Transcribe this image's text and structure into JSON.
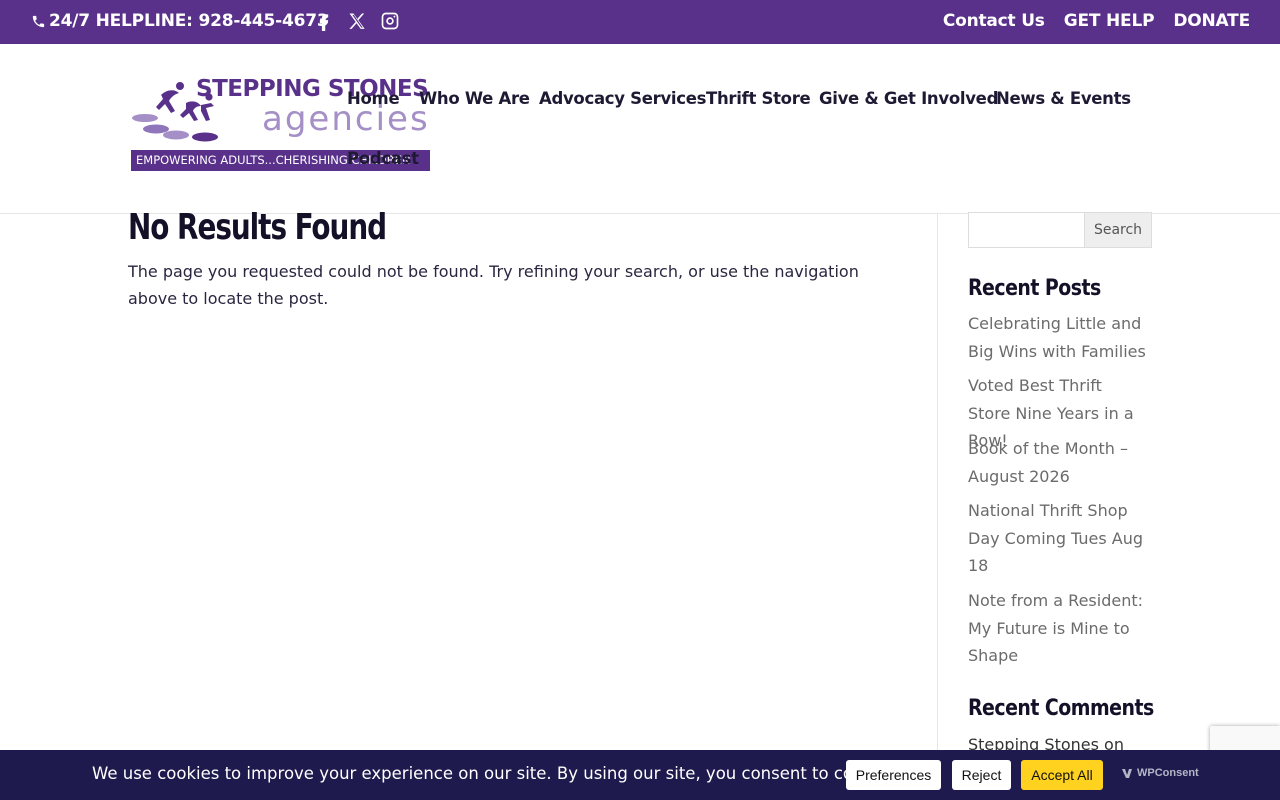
{
  "topbar": {
    "helpline": "24/7 HELPLINE: 928-445-4673",
    "links": [
      "Contact Us",
      "GET HELP",
      "DONATE"
    ],
    "social": [
      "facebook-icon",
      "x-icon",
      "instagram-icon"
    ]
  },
  "logo": {
    "title": "STEPPING STONES",
    "subtitle": "agencies",
    "tagline": "EMPOWERING ADULTS...CHERISHING CHILDREN"
  },
  "nav": {
    "items": [
      "Home",
      "Who We Are",
      "Advocacy Services",
      "Thrift Store",
      "Give & Get Involved",
      "News & Events",
      "Podcast"
    ]
  },
  "main": {
    "title": "No Results Found",
    "text": "The page you requested could not be found. Try refining your search, or use the navigation above to locate the post."
  },
  "sidebar": {
    "search_button": "Search",
    "recent_posts_title": "Recent Posts",
    "recent_posts": [
      "Celebrating Little and Big Wins with Families",
      "Voted Best Thrift Store Nine Years in a Row!",
      "Book of the Month – August 2026",
      "National Thrift Shop Day Coming Tues Aug 18",
      "Note from a Resident: My Future is Mine to Shape"
    ],
    "recent_comments_title": "Recent Comments",
    "recent_comment": "Stepping Stones on"
  },
  "cookie": {
    "text": "We use cookies to improve your experience on our site. By using our site, you consent to cookies.",
    "preferences": "Preferences",
    "reject": "Reject",
    "accept": "Accept All",
    "brand": "WPConsent"
  },
  "colors": {
    "brand_purple": "#59318a",
    "logo_lavender": "#a48fc7",
    "cookie_bg": "#1e1a4d",
    "accept_yellow": "#ffd21f"
  }
}
